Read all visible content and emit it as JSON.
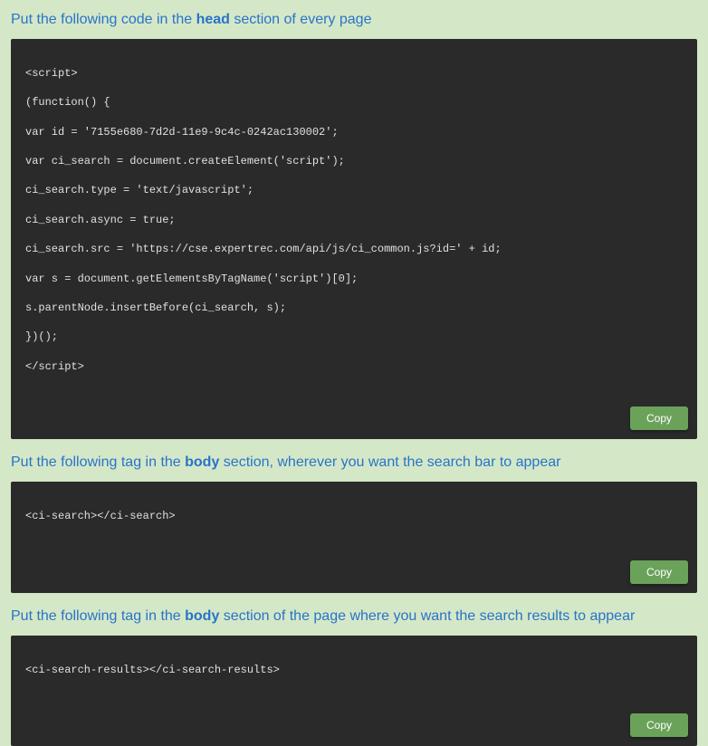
{
  "section1": {
    "heading_pre": "Put the following code in the ",
    "heading_bold": "head",
    "heading_post": " section of every page",
    "code_lines": [
      "<script>",
      "(function() {",
      "var id = '7155e680-7d2d-11e9-9c4c-0242ac130002';",
      "var ci_search = document.createElement('script');",
      "ci_search.type = 'text/javascript';",
      "ci_search.async = true;",
      "ci_search.src = 'https://cse.expertrec.com/api/js/ci_common.js?id=' + id;",
      "var s = document.getElementsByTagName('script')[0];",
      "s.parentNode.insertBefore(ci_search, s);",
      "})();",
      "</script>"
    ],
    "copy_label": "Copy"
  },
  "section2": {
    "heading_pre": "Put the following tag in the ",
    "heading_bold": "body",
    "heading_post": " section, wherever you want the search bar to appear",
    "code_lines": [
      "<ci-search></ci-search>"
    ],
    "copy_label": "Copy"
  },
  "section3": {
    "heading_pre": "Put the following tag in the ",
    "heading_bold": "body",
    "heading_post": " section of the page where you want the search results to appear",
    "code_lines": [
      "<ci-search-results></ci-search-results>"
    ],
    "copy_label": "Copy"
  }
}
